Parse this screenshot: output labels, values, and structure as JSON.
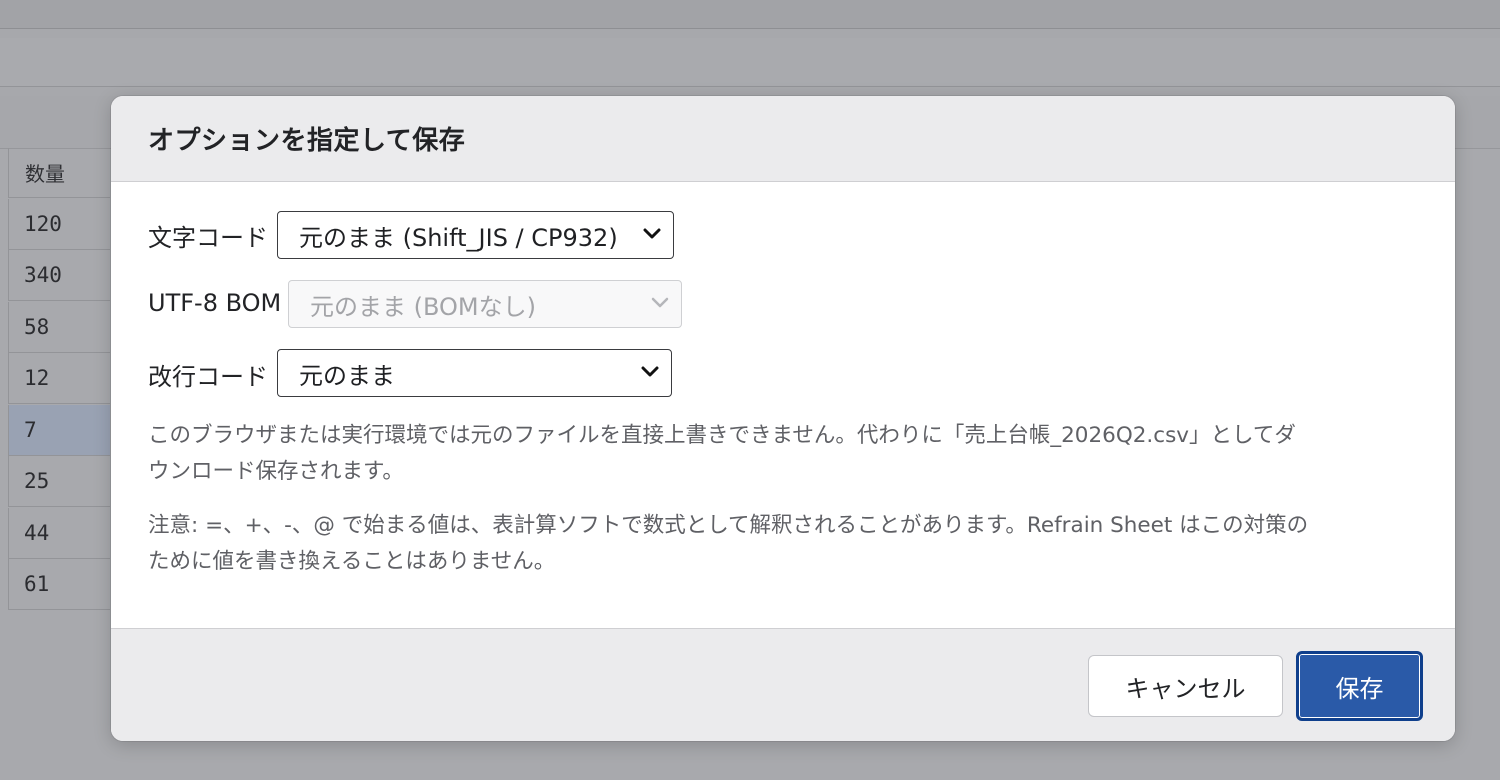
{
  "background": {
    "column_header": "数量",
    "quantities": [
      "120",
      "340",
      "58",
      "12",
      "7",
      "25",
      "44",
      "61"
    ]
  },
  "dialog": {
    "title": "オプションを指定して保存",
    "encoding": {
      "label": "文字コード",
      "value": "元のまま (Shift_JIS / CP932)"
    },
    "bom": {
      "label": "UTF-8 BOM",
      "value": "元のまま (BOMなし)",
      "disabled": true
    },
    "newline": {
      "label": "改行コード",
      "value": "元のまま"
    },
    "note_download_line1": "このブラウザまたは実行環境では元のファイルを直接上書きできません。代わりに「売上台帳_2026Q2.csv」としてダ",
    "note_download_line2": "ウンロード保存されます。",
    "note_formula_line1": "注意: =、+、-、@ で始まる値は、表計算ソフトで数式として解釈されることがあります。Refrain Sheet はこの対策の",
    "note_formula_line2": "ために値を書き換えることはありません。",
    "cancel_label": "キャンセル",
    "save_label": "保存"
  },
  "colors": {
    "accent": "#2a5aa8",
    "overlay": "#a7a8ac",
    "selected_row": "#99a2b3"
  }
}
